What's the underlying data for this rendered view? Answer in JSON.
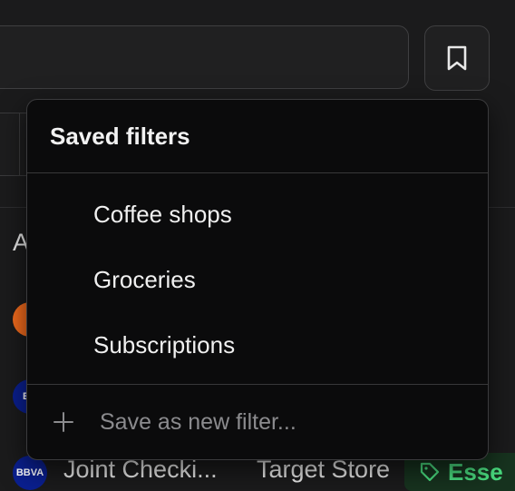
{
  "toolbar": {
    "bookmark_icon": "bookmark-icon"
  },
  "background": {
    "column_header_partial": "A",
    "rows": [
      {
        "avatar": "",
        "avatar_color": "#f26b1d"
      },
      {
        "avatar": "BB",
        "avatar_color": "#0a1f8f"
      },
      {
        "avatar": "BBVA",
        "avatar_color": "#0a1f8f",
        "account": "Joint Checki...",
        "merchant": "Target Store",
        "tag": "Esse",
        "tag_icon": "tag-icon",
        "tag_color": "#4ade80"
      }
    ]
  },
  "saved_filters": {
    "title": "Saved filters",
    "items": [
      {
        "label": "Coffee shops"
      },
      {
        "label": "Groceries"
      },
      {
        "label": "Subscriptions"
      }
    ],
    "save_new_placeholder": "Save as new filter...",
    "save_new_icon": "plus-icon"
  },
  "colors": {
    "background": "#1b1b1c",
    "dropdown_bg": "#0b0b0c",
    "border": "#3b3b3d",
    "accent_green": "#4ade80"
  }
}
